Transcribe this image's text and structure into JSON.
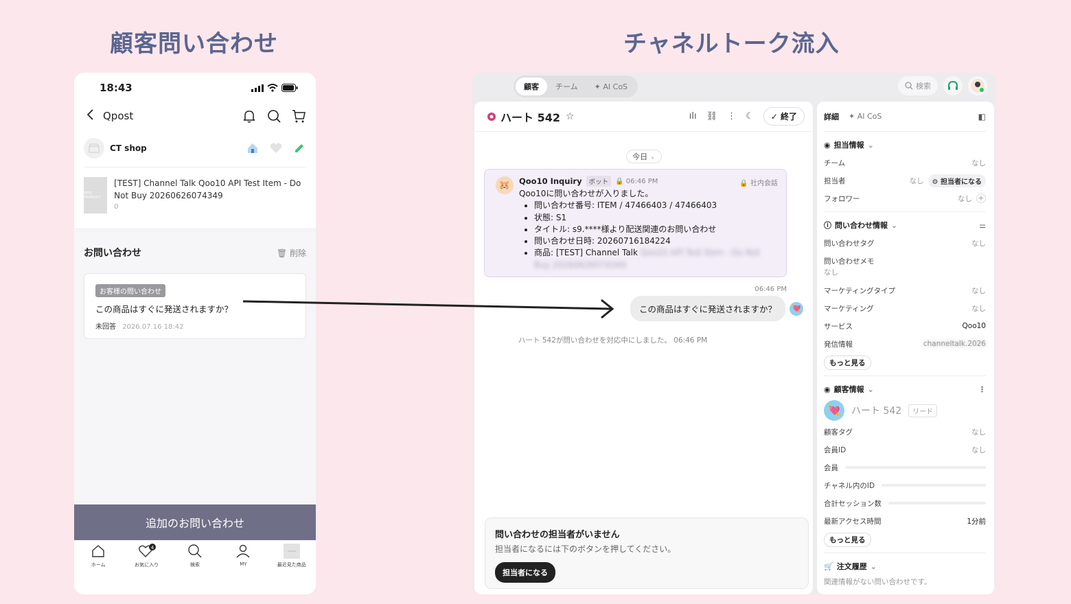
{
  "headings": {
    "left": "顧客問い合わせ",
    "right": "チャネルトーク流入"
  },
  "phone": {
    "status_time": "18:43",
    "nav_title": "Qpost",
    "shop_name": "CT shop",
    "item_title": "[TEST] Channel Talk Qoo10 API Test Item - Do Not Buy 20260626074349",
    "item_sub": "0",
    "thumb_text": "TEST PRODUCT",
    "inquiry_title": "お問い合わせ",
    "delete_label": "削除",
    "card_badge": "お客様の問い合わせ",
    "card_question": "この商品はすぐに発送されますか？",
    "card_status": "未回答",
    "card_date": "2026.07.16 18:42",
    "add_button": "追加のお問い合わせ",
    "tabs": [
      {
        "label": "ホーム",
        "icon": "home-icon"
      },
      {
        "label": "お気に入り",
        "icon": "heart-icon",
        "badge": "4"
      },
      {
        "label": "検索",
        "icon": "search-icon"
      },
      {
        "label": "MY",
        "icon": "user-icon"
      },
      {
        "label": "最近見た商品",
        "icon": "recent-item-icon"
      }
    ]
  },
  "desk": {
    "top_tabs": [
      "顧客",
      "チーム",
      "✦ AI CoS"
    ],
    "search_placeholder": "検索",
    "chat": {
      "title": "ハート 542",
      "end_button": "終了",
      "day_label": "今日",
      "bot_name": "Qoo10 Inquiry",
      "bot_tag": "ボット",
      "bot_time": "06:46 PM",
      "internal_label": "社内会話",
      "bot_intro": "Qoo10に問い合わせが入りました。",
      "bot_items": [
        "問い合わせ番号: ITEM / 47466403 / 47466403",
        "状態: S1",
        "タイトル: s9.****様より配送関連のお問い合わせ",
        "問い合わせ日時: 20260716184224",
        "商品: [TEST] Channel Talk"
      ],
      "message_time": "06:46 PM",
      "message_text": "この商品はすぐに発送されますか？",
      "system_note": "ハート 542が問い合わせを対応中にしました。 06:46 PM",
      "assign_title": "問い合わせの担当者がいません",
      "assign_desc": "担当者になるには下のボタンを押してください。",
      "assign_button": "担当者になる"
    },
    "side": {
      "tab_detail": "詳細",
      "tab_ai": "✦ AI CoS",
      "assignee_section": "担当情報",
      "team_label": "チーム",
      "team_value": "なし",
      "assignee_label": "担当者",
      "assignee_value": "なし",
      "become_assignee": "担当者になる",
      "follower_label": "フォロワー",
      "follower_value": "なし",
      "inquiry_section": "問い合わせ情報",
      "tag_label": "問い合わせタグ",
      "tag_value": "なし",
      "memo_label": "問い合わせメモ",
      "memo_value": "なし",
      "mtype_label": "マーケティングタイプ",
      "mtype_value": "なし",
      "marketing_label": "マーケティング",
      "marketing_value": "なし",
      "service_label": "サービス",
      "service_value": "Qoo10",
      "sender_label": "発信情報",
      "more_1": "もっと見る",
      "customer_section": "顧客情報",
      "customer_name": "ハート 542",
      "lead_label": "リード",
      "ctag_label": "顧客タグ",
      "ctag_value": "なし",
      "member_id_label": "会員ID",
      "member_id_value": "なし",
      "member_label": "会員",
      "channel_id_label": "チャネル内のID",
      "sessions_label": "合計セッション数",
      "last_access_label": "最新アクセス時間",
      "last_access_value": "1分前",
      "more_2": "もっと見る",
      "orders_section": "注文履歴",
      "orders_note": "関連情報がない問い合わせです。"
    }
  },
  "colors": {
    "background": "#fce7ec",
    "heading": "#5b6690",
    "add_button": "#6f7088",
    "brand": "#d0407a"
  }
}
